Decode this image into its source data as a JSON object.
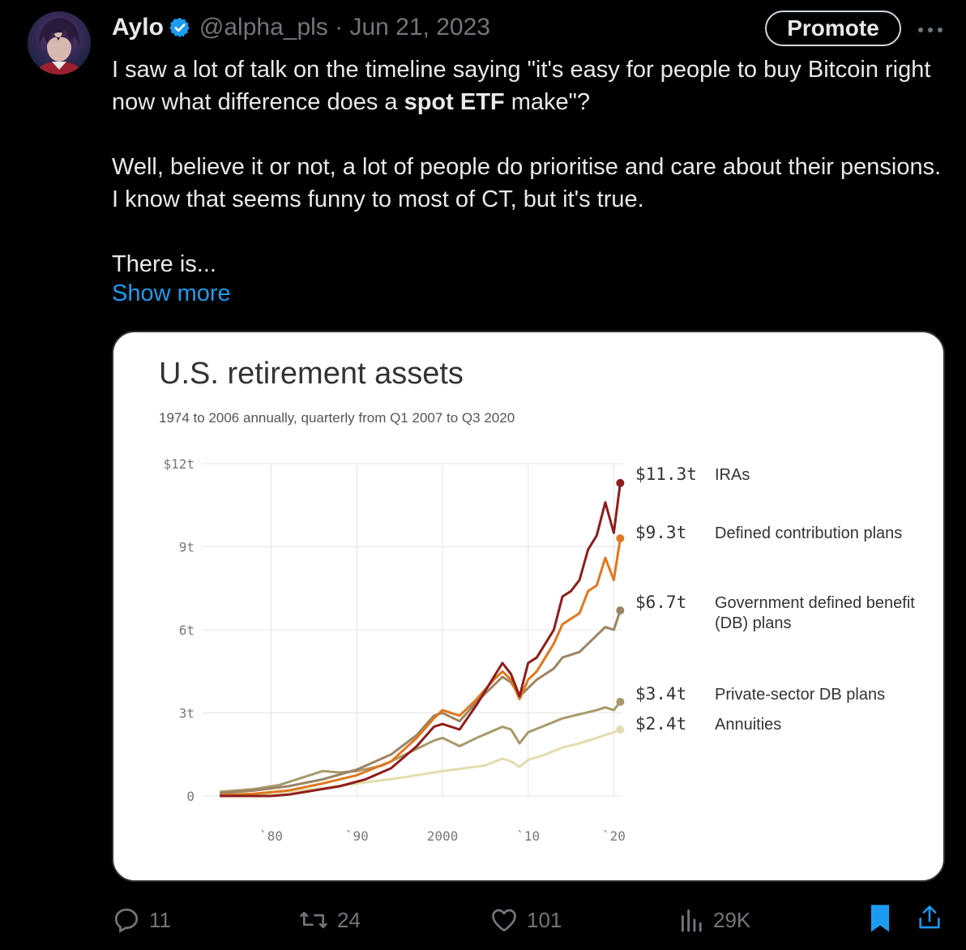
{
  "tweet": {
    "author_name": "Aylo",
    "handle_date": "@alpha_pls · Jun 21, 2023",
    "promote_label": "Promote",
    "more_label": "···",
    "text": {
      "p1_before": "I saw a lot of talk on the timeline saying \"it's easy for people to buy Bitcoin right now what difference does a ",
      "p1_bold": "spot ETF",
      "p1_after": " make\"?",
      "p2": "Well, believe it or not, a lot of people do prioritise and care about their pensions. I know that seems funny to most of CT, but it's true.",
      "p3": "There is..."
    },
    "show_more": "Show more"
  },
  "actions": {
    "replies": "11",
    "retweets": "24",
    "likes": "101",
    "views": "29K"
  },
  "chart_data": {
    "type": "line",
    "title": "U.S. retirement assets",
    "subtitle": "1974 to 2006 annually, quarterly from Q1 2007 to Q3 2020",
    "ylim": [
      0,
      12
    ],
    "xlim": [
      1974,
      2020.75
    ],
    "y_ticks": [
      {
        "value": 0,
        "label": "0"
      },
      {
        "value": 3,
        "label": "3t"
      },
      {
        "value": 6,
        "label": "6t"
      },
      {
        "value": 9,
        "label": "9t"
      },
      {
        "value": 12,
        "label": "$12t"
      }
    ],
    "x_ticks": [
      {
        "value": 1980,
        "label": "`80"
      },
      {
        "value": 1990,
        "label": "`90"
      },
      {
        "value": 2000,
        "label": "2000"
      },
      {
        "value": 2010,
        "label": "`10"
      },
      {
        "value": 2020,
        "label": "`20"
      }
    ],
    "series": [
      {
        "name": "Annuities",
        "end_label": "$2.4t",
        "color": "#e2dcae",
        "points": [
          [
            1974,
            0.04
          ],
          [
            1980,
            0.1
          ],
          [
            1985,
            0.25
          ],
          [
            1990,
            0.45
          ],
          [
            1995,
            0.65
          ],
          [
            2000,
            0.9
          ],
          [
            2005,
            1.1
          ],
          [
            2007,
            1.35
          ],
          [
            2008,
            1.25
          ],
          [
            2009,
            1.05
          ],
          [
            2010,
            1.3
          ],
          [
            2012,
            1.5
          ],
          [
            2014,
            1.75
          ],
          [
            2016,
            1.9
          ],
          [
            2018,
            2.1
          ],
          [
            2019,
            2.2
          ],
          [
            2020,
            2.3
          ],
          [
            2020.75,
            2.4
          ]
        ]
      },
      {
        "name": "Private-sector DB plans",
        "end_label": "$3.4t",
        "color": "#a79a6a",
        "points": [
          [
            1974,
            0.15
          ],
          [
            1978,
            0.25
          ],
          [
            1981,
            0.4
          ],
          [
            1984,
            0.7
          ],
          [
            1986,
            0.9
          ],
          [
            1988,
            0.85
          ],
          [
            1990,
            0.9
          ],
          [
            1993,
            1.1
          ],
          [
            1995,
            1.4
          ],
          [
            1997,
            1.7
          ],
          [
            1999,
            2.0
          ],
          [
            2000,
            2.1
          ],
          [
            2002,
            1.8
          ],
          [
            2004,
            2.1
          ],
          [
            2007,
            2.5
          ],
          [
            2008,
            2.4
          ],
          [
            2009,
            1.9
          ],
          [
            2010,
            2.3
          ],
          [
            2012,
            2.55
          ],
          [
            2014,
            2.8
          ],
          [
            2016,
            2.95
          ],
          [
            2018,
            3.1
          ],
          [
            2019,
            3.2
          ],
          [
            2020,
            3.1
          ],
          [
            2020.75,
            3.4
          ]
        ]
      },
      {
        "name": "Government defined benefit (DB) plans",
        "end_label": "$6.7t",
        "color": "#9c8463",
        "points": [
          [
            1974,
            0.1
          ],
          [
            1978,
            0.2
          ],
          [
            1982,
            0.35
          ],
          [
            1986,
            0.6
          ],
          [
            1990,
            0.95
          ],
          [
            1994,
            1.5
          ],
          [
            1997,
            2.2
          ],
          [
            1999,
            2.9
          ],
          [
            2000,
            3.0
          ],
          [
            2002,
            2.7
          ],
          [
            2004,
            3.4
          ],
          [
            2006,
            4.0
          ],
          [
            2007,
            4.3
          ],
          [
            2008,
            4.1
          ],
          [
            2009,
            3.6
          ],
          [
            2010,
            3.9
          ],
          [
            2011,
            4.2
          ],
          [
            2013,
            4.6
          ],
          [
            2014,
            5.0
          ],
          [
            2016,
            5.2
          ],
          [
            2018,
            5.8
          ],
          [
            2019,
            6.1
          ],
          [
            2020,
            6.0
          ],
          [
            2020.75,
            6.7
          ]
        ]
      },
      {
        "name": "Defined contribution plans",
        "end_label": "$9.3t",
        "color": "#e0781e",
        "points": [
          [
            1974,
            0.02
          ],
          [
            1978,
            0.08
          ],
          [
            1982,
            0.2
          ],
          [
            1986,
            0.45
          ],
          [
            1990,
            0.75
          ],
          [
            1994,
            1.25
          ],
          [
            1997,
            2.1
          ],
          [
            1999,
            2.8
          ],
          [
            2000,
            3.1
          ],
          [
            2002,
            2.9
          ],
          [
            2004,
            3.5
          ],
          [
            2006,
            4.2
          ],
          [
            2007,
            4.5
          ],
          [
            2008,
            4.2
          ],
          [
            2009,
            3.5
          ],
          [
            2010,
            4.2
          ],
          [
            2011,
            4.5
          ],
          [
            2013,
            5.5
          ],
          [
            2014,
            6.2
          ],
          [
            2015,
            6.4
          ],
          [
            2016,
            6.6
          ],
          [
            2017,
            7.4
          ],
          [
            2018,
            7.6
          ],
          [
            2019,
            8.6
          ],
          [
            2020,
            7.8
          ],
          [
            2020.75,
            9.3
          ]
        ]
      },
      {
        "name": "IRAs",
        "end_label": "$11.3t",
        "color": "#8e1d1a",
        "points": [
          [
            1974,
            0.0
          ],
          [
            1980,
            0.0
          ],
          [
            1982,
            0.05
          ],
          [
            1985,
            0.2
          ],
          [
            1988,
            0.35
          ],
          [
            1991,
            0.6
          ],
          [
            1994,
            1.0
          ],
          [
            1997,
            1.8
          ],
          [
            1999,
            2.5
          ],
          [
            2000,
            2.6
          ],
          [
            2002,
            2.4
          ],
          [
            2004,
            3.3
          ],
          [
            2006,
            4.3
          ],
          [
            2007,
            4.8
          ],
          [
            2008,
            4.4
          ],
          [
            2009,
            3.6
          ],
          [
            2010,
            4.8
          ],
          [
            2011,
            5.0
          ],
          [
            2013,
            6.0
          ],
          [
            2014,
            7.2
          ],
          [
            2015,
            7.4
          ],
          [
            2016,
            7.8
          ],
          [
            2017,
            8.9
          ],
          [
            2018,
            9.4
          ],
          [
            2019,
            10.6
          ],
          [
            2020,
            9.5
          ],
          [
            2020.75,
            11.3
          ]
        ]
      }
    ]
  }
}
